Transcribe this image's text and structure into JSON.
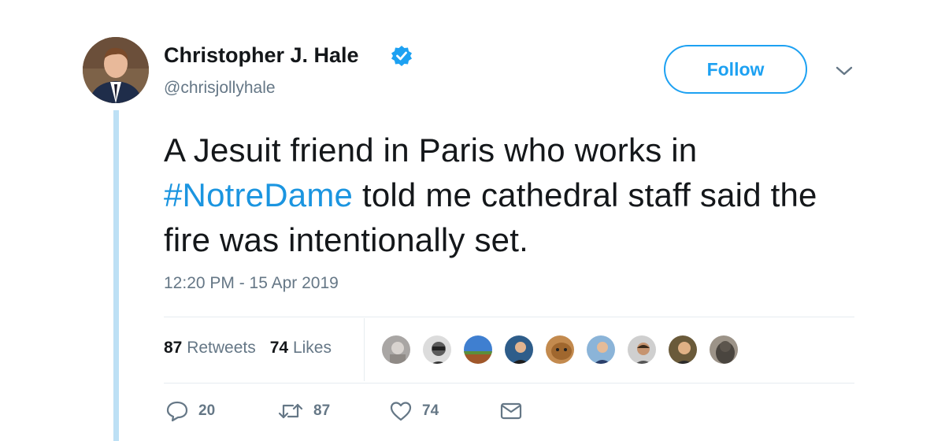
{
  "tweet": {
    "author": {
      "display_name": "Christopher J. Hale",
      "handle": "@chrisjollyhale",
      "verified_icon": "verified-badge-icon"
    },
    "follow_label": "Follow",
    "text_before": "A Jesuit friend in Paris who works in",
    "hashtag": "#NotreDame",
    "text_after": " told me cathedral staff said the fire was intentionally set.",
    "timestamp": "12:20 PM - 15 Apr 2019",
    "stats": {
      "retweets_count": "87",
      "retweets_label": "Retweets",
      "likes_count": "74",
      "likes_label": "Likes"
    },
    "actions": {
      "reply_count": "20",
      "retweet_count": "87",
      "like_count": "74"
    }
  },
  "colors": {
    "accent": "#1da1f2",
    "hashtag": "#1b95e0",
    "muted": "#657786",
    "thread_line": "#bde0f5"
  }
}
